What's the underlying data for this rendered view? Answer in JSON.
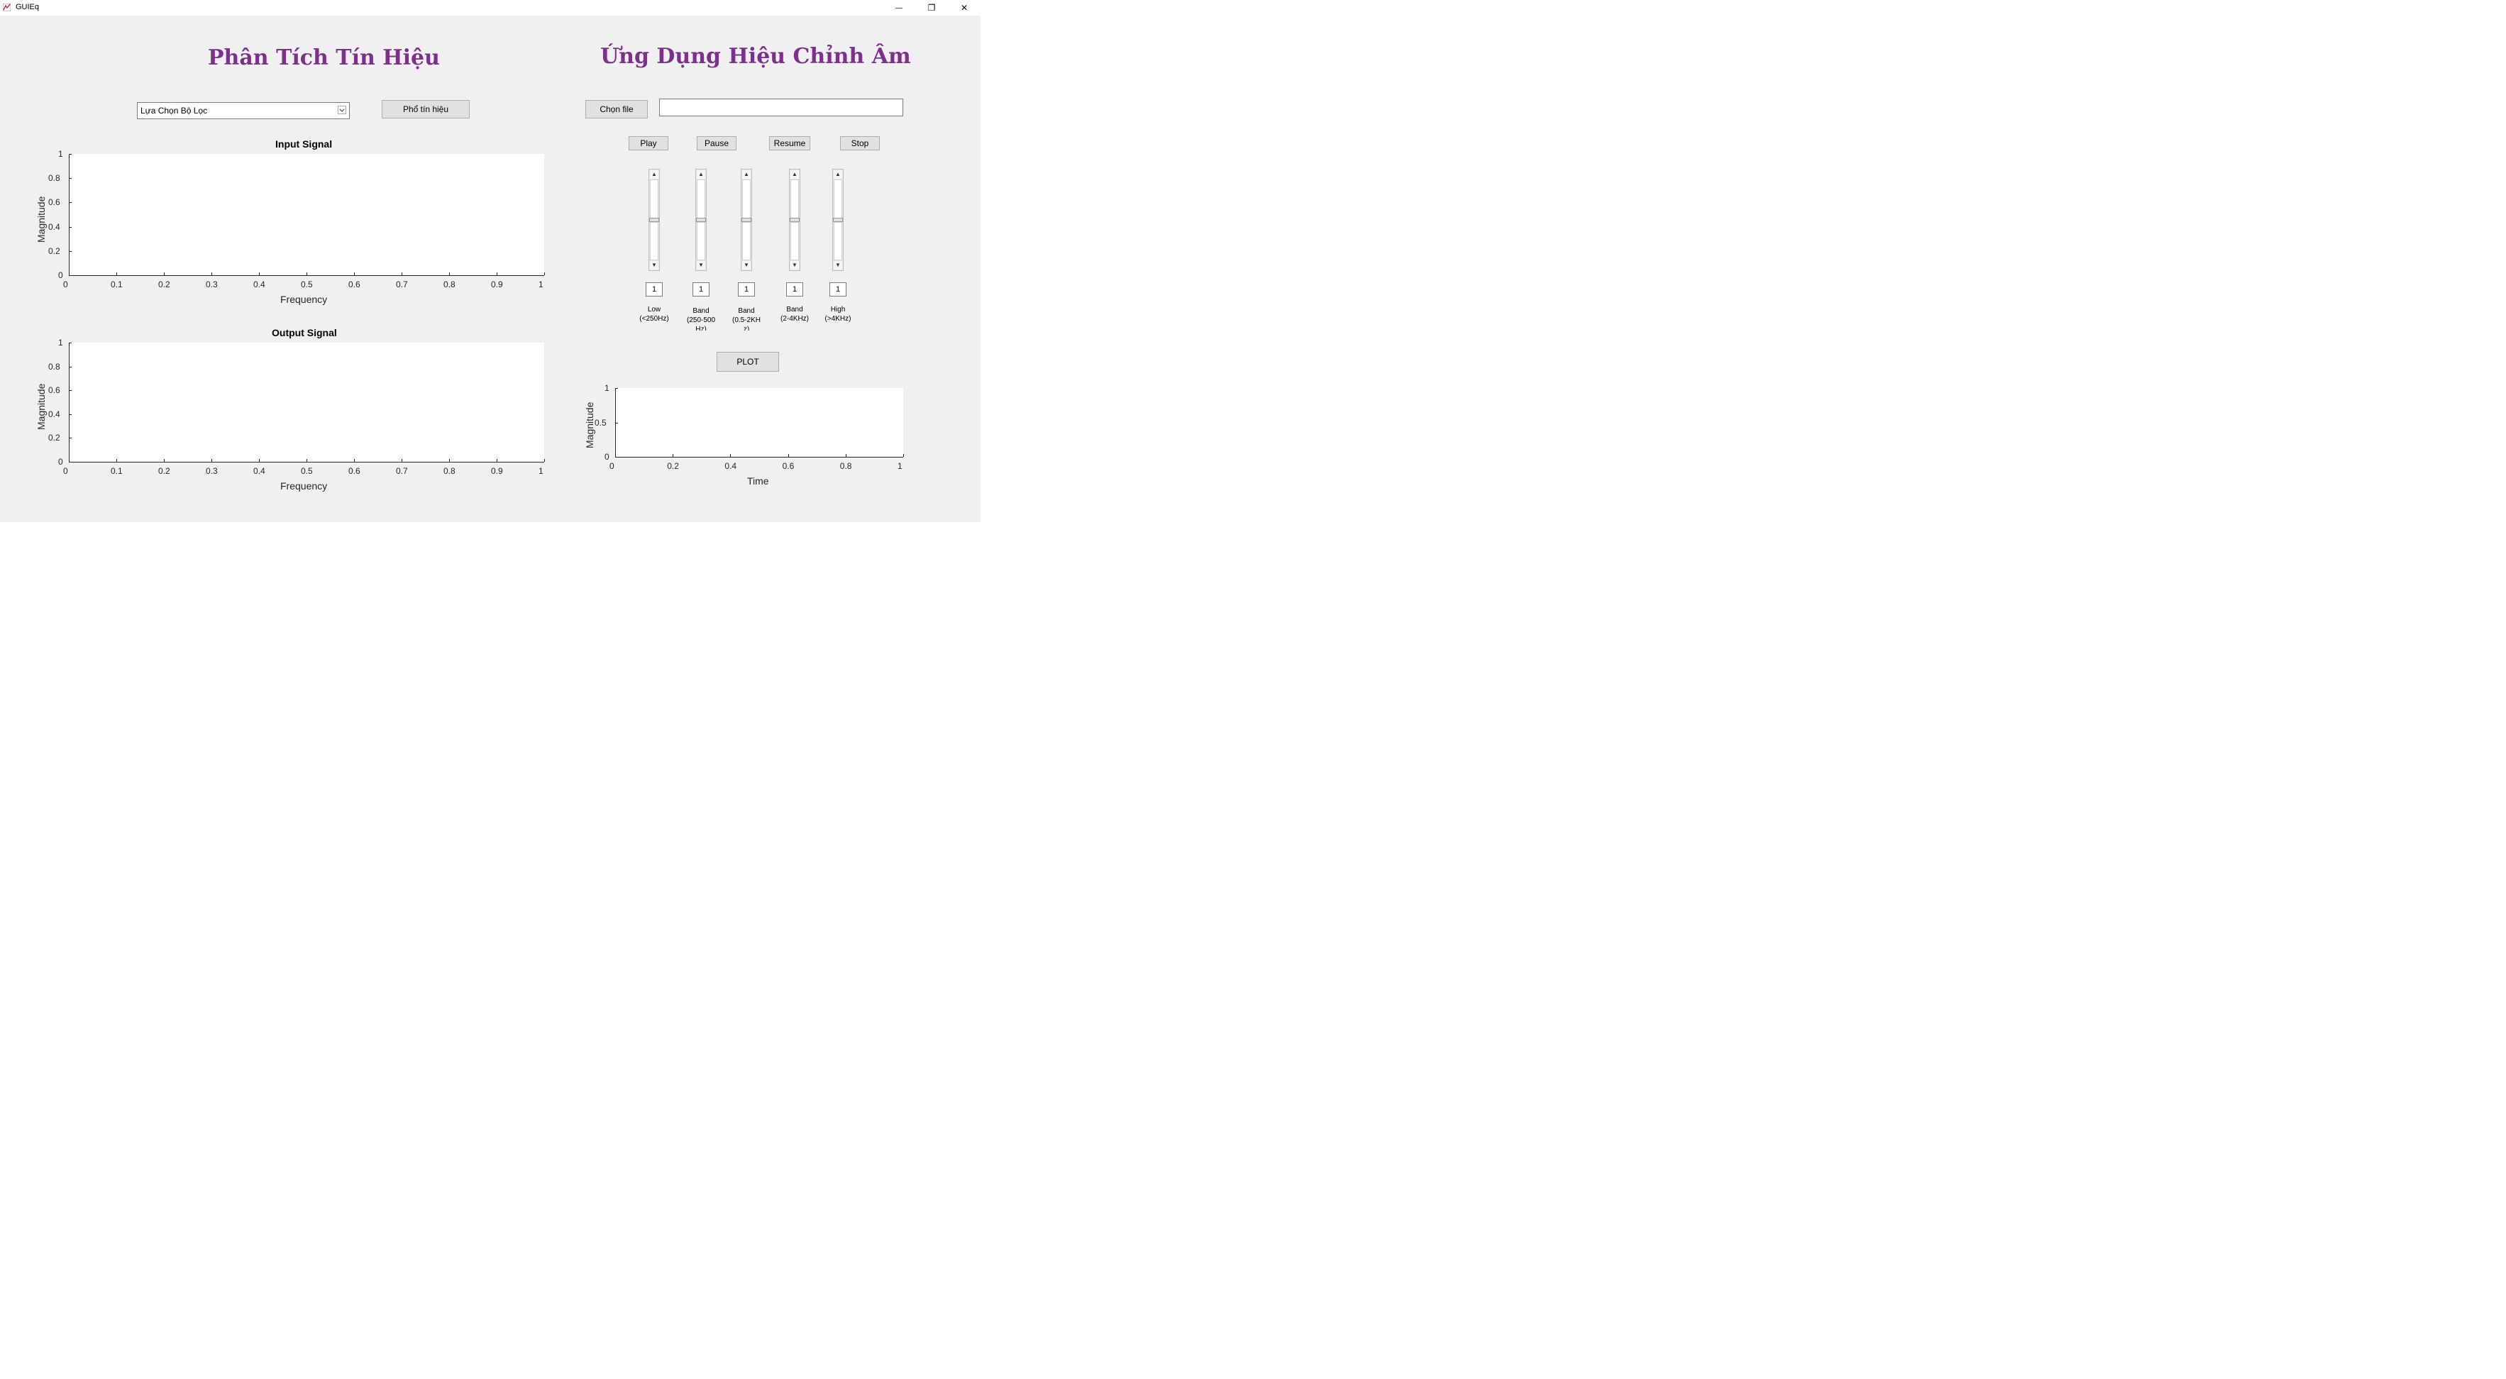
{
  "window": {
    "title": "GUIEq",
    "minimize_glyph": "—",
    "restore_glyph": "❐",
    "close_glyph": "✕"
  },
  "left": {
    "heading": "Phân Tích Tín Hiệu",
    "filter_select": "Lựa Chọn Bộ Lọc",
    "spectrum_button": "Phổ tín hiệu",
    "input_axes": {
      "title": "Input Signal",
      "xlabel": "Frequency",
      "ylabel": "Magnitude",
      "xticks": [
        "0",
        "0.1",
        "0.2",
        "0.3",
        "0.4",
        "0.5",
        "0.6",
        "0.7",
        "0.8",
        "0.9",
        "1"
      ],
      "yticks": [
        "0",
        "0.2",
        "0.4",
        "0.6",
        "0.8",
        "1"
      ]
    },
    "output_axes": {
      "title": "Output Signal",
      "xlabel": "Frequency",
      "ylabel": "Magnitude",
      "xticks": [
        "0",
        "0.1",
        "0.2",
        "0.3",
        "0.4",
        "0.5",
        "0.6",
        "0.7",
        "0.8",
        "0.9",
        "1"
      ],
      "yticks": [
        "0",
        "0.2",
        "0.4",
        "0.6",
        "0.8",
        "1"
      ]
    }
  },
  "right": {
    "heading": "Ứng Dụng Hiệu Chỉnh Âm",
    "choose_file_button": "Chọn file",
    "file_path_value": "",
    "playback": {
      "play": "Play",
      "pause": "Pause",
      "resume": "Resume",
      "stop": "Stop"
    },
    "bands": [
      {
        "value": "1",
        "label_line1": "Low",
        "label_line2": "(<250Hz)",
        "label_line3": ""
      },
      {
        "value": "1",
        "label_line1": "Band",
        "label_line2": "(250-500",
        "label_line3": "Hz)"
      },
      {
        "value": "1",
        "label_line1": "Band",
        "label_line2": "(0.5-2KH",
        "label_line3": "z)"
      },
      {
        "value": "1",
        "label_line1": "Band",
        "label_line2": "(2-4KHz)",
        "label_line3": ""
      },
      {
        "value": "1",
        "label_line1": "High",
        "label_line2": "(>4KHz)",
        "label_line3": ""
      }
    ],
    "plot_button": "PLOT",
    "time_axes": {
      "xlabel": "Time",
      "ylabel": "Magnitude",
      "xticks": [
        "0",
        "0.2",
        "0.4",
        "0.6",
        "0.8",
        "1"
      ],
      "yticks": [
        "0",
        "0.5",
        "1"
      ]
    }
  },
  "colors": {
    "heading": "#7e2f8e",
    "panel_bg": "#f0f0f0",
    "button_bg": "#e1e1e1"
  }
}
